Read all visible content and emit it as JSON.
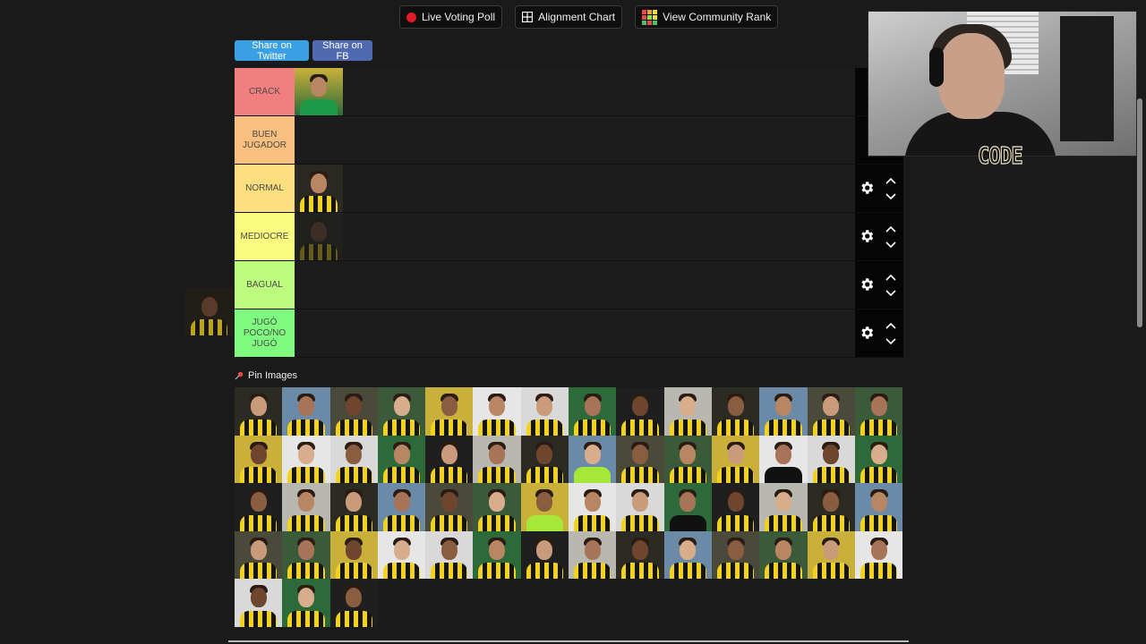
{
  "toolbar": {
    "live_voting": "Live Voting Poll",
    "alignment": "Alignment Chart",
    "community": "View Community Rank"
  },
  "share": {
    "twitter": "Share on Twitter",
    "facebook": "Share on FB"
  },
  "tiers": [
    {
      "label": "CRACK",
      "color": "#f27f7f",
      "players": 1
    },
    {
      "label": "BUEN JUGADOR",
      "color": "#f8bf7f",
      "players": 0
    },
    {
      "label": "NORMAL",
      "color": "#fbdf7f",
      "players": 1
    },
    {
      "label": "MEDIOCRE",
      "color": "#fbfb7f",
      "players": 1
    },
    {
      "label": "BAGUAL",
      "color": "#bdfb7f",
      "players": 0
    },
    {
      "label": "JUGÓ POCO/NO JUGÓ",
      "color": "#7ffb7f",
      "players": 0
    }
  ],
  "pin_images_label": "Pin Images",
  "pool_count": 59,
  "webcam": {
    "overlay_text": "CODE"
  },
  "colors": {
    "brand_yellow": "#f2d21b",
    "twitter_blue": "#3aa0e3",
    "facebook_blue": "#4f6ab0",
    "live_red": "#e01b24"
  }
}
